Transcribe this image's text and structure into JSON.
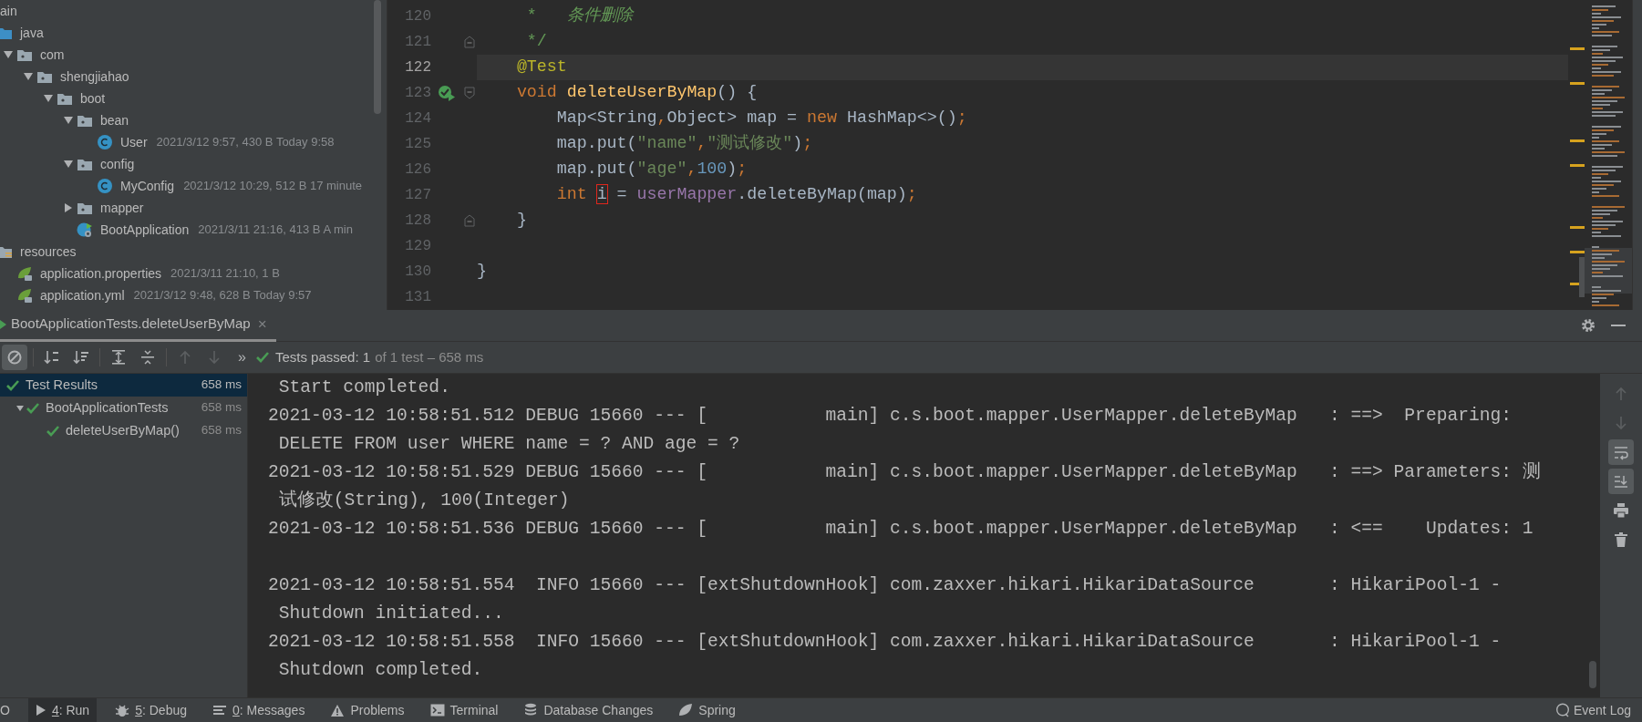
{
  "project_tree": {
    "items": [
      {
        "label": "ain",
        "children": [
          {
            "label": "java",
            "kind": "source-folder",
            "children": [
              {
                "label": "com",
                "kind": "package",
                "expanded": true,
                "children": [
                  {
                    "label": "shengjiahao",
                    "kind": "package",
                    "expanded": true,
                    "children": [
                      {
                        "label": "boot",
                        "kind": "package",
                        "expanded": true,
                        "children": [
                          {
                            "label": "bean",
                            "kind": "package",
                            "expanded": true,
                            "children": [
                              {
                                "label": "User",
                                "kind": "class",
                                "meta": "2021/3/12 9:57, 430 B Today 9:58"
                              }
                            ]
                          },
                          {
                            "label": "config",
                            "kind": "package",
                            "expanded": true,
                            "children": [
                              {
                                "label": "MyConfig",
                                "kind": "class",
                                "meta": "2021/3/12 10:29, 512 B 17 minute"
                              }
                            ]
                          },
                          {
                            "label": "mapper",
                            "kind": "package",
                            "expanded": false
                          },
                          {
                            "label": "BootApplication",
                            "kind": "spring-app",
                            "meta": "2021/3/11 21:16, 413 B A min"
                          }
                        ]
                      }
                    ]
                  }
                ]
              }
            ]
          },
          {
            "label": "resources",
            "kind": "resources-folder",
            "children": [
              {
                "label": "application.properties",
                "kind": "spring-config",
                "meta": "2021/3/11 21:10, 1 B"
              },
              {
                "label": "application.yml",
                "kind": "spring-config",
                "meta": "2021/3/12 9:48, 628 B Today 9:57"
              }
            ]
          }
        ]
      }
    ]
  },
  "editor": {
    "lines": [
      {
        "number": "120",
        "current": false,
        "run_marker": false,
        "fold_start": false,
        "fold_end": false,
        "tokens": [
          {
            "kind": "comment",
            "text": "     *   "
          },
          {
            "kind": "doc-text",
            "text": "条件删除"
          }
        ]
      },
      {
        "number": "121",
        "current": false,
        "run_marker": false,
        "fold_start": false,
        "fold_end": true,
        "tokens": [
          {
            "kind": "comment",
            "text": "     */"
          }
        ]
      },
      {
        "number": "122",
        "current": true,
        "run_marker": false,
        "fold_start": false,
        "fold_end": false,
        "tokens": [
          {
            "kind": "annotation",
            "text": "    @Test"
          }
        ]
      },
      {
        "number": "123",
        "current": false,
        "run_marker": true,
        "fold_start": true,
        "fold_end": false,
        "tokens": [
          {
            "kind": "keyword",
            "text": "    void "
          },
          {
            "kind": "method",
            "text": "deleteUserByMap"
          },
          {
            "kind": "plain",
            "text": "() {"
          }
        ]
      },
      {
        "number": "124",
        "current": false,
        "run_marker": false,
        "fold_start": false,
        "fold_end": false,
        "tokens": [
          {
            "kind": "plain",
            "text": "        Map<String"
          },
          {
            "kind": "keyword",
            "text": ","
          },
          {
            "kind": "plain",
            "text": "Object> map = "
          },
          {
            "kind": "keyword",
            "text": "new"
          },
          {
            "kind": "plain",
            "text": " HashMap<>()"
          },
          {
            "kind": "keyword",
            "text": ";"
          }
        ]
      },
      {
        "number": "125",
        "current": false,
        "run_marker": false,
        "fold_start": false,
        "fold_end": false,
        "tokens": [
          {
            "kind": "plain",
            "text": "        map.put("
          },
          {
            "kind": "string",
            "text": "\"name\""
          },
          {
            "kind": "keyword",
            "text": ","
          },
          {
            "kind": "string",
            "text": "\"测试修改\""
          },
          {
            "kind": "plain",
            "text": ")"
          },
          {
            "kind": "keyword",
            "text": ";"
          }
        ]
      },
      {
        "number": "126",
        "current": false,
        "run_marker": false,
        "fold_start": false,
        "fold_end": false,
        "tokens": [
          {
            "kind": "plain",
            "text": "        map.put("
          },
          {
            "kind": "string",
            "text": "\"age\""
          },
          {
            "kind": "keyword",
            "text": ","
          },
          {
            "kind": "number",
            "text": "100"
          },
          {
            "kind": "plain",
            "text": ")"
          },
          {
            "kind": "keyword",
            "text": ";"
          }
        ]
      },
      {
        "number": "127",
        "current": false,
        "run_marker": false,
        "fold_start": false,
        "fold_end": false,
        "tokens": [
          {
            "kind": "keyword",
            "text": "        int "
          },
          {
            "kind": "marked",
            "text": "i"
          },
          {
            "kind": "plain",
            "text": " = "
          },
          {
            "kind": "field",
            "text": "userMapper"
          },
          {
            "kind": "plain",
            "text": ".deleteByMap(map)"
          },
          {
            "kind": "keyword",
            "text": ";"
          }
        ]
      },
      {
        "number": "128",
        "current": false,
        "run_marker": false,
        "fold_start": false,
        "fold_end": true,
        "tokens": [
          {
            "kind": "plain",
            "text": "    }"
          }
        ]
      },
      {
        "number": "129",
        "current": false,
        "run_marker": false,
        "fold_start": false,
        "fold_end": false
      },
      {
        "number": "130",
        "current": false,
        "run_marker": false,
        "fold_start": false,
        "fold_end": false,
        "tokens": [
          {
            "kind": "plain",
            "text": "}"
          }
        ]
      },
      {
        "number": "131",
        "current": false,
        "run_marker": false,
        "fold_start": false,
        "fold_end": false
      }
    ]
  },
  "run_panel": {
    "tab": {
      "label": "BootApplicationTests.deleteUserByMap",
      "close": "×"
    },
    "tools": [
      {
        "kind": "show-passed",
        "on": true,
        "disabled": false
      },
      {
        "kind": "sort-alpha",
        "on": false,
        "disabled": false
      },
      {
        "kind": "sort-duration",
        "on": false,
        "disabled": false
      },
      {
        "kind": "expand-all",
        "on": false,
        "disabled": false
      },
      {
        "kind": "collapse-all",
        "on": false,
        "disabled": false
      },
      {
        "kind": "previous",
        "on": false,
        "disabled": true
      },
      {
        "kind": "next",
        "on": false,
        "disabled": true
      }
    ],
    "overflow": "»",
    "status": {
      "passed": true,
      "summary": "Tests passed: 1",
      "detail": "of 1 test – 658 ms"
    },
    "test_tree": [
      {
        "label": "Test Results",
        "duration": "658 ms",
        "passed": true,
        "selected": true,
        "children": [
          {
            "label": "BootApplicationTests",
            "duration": "658 ms",
            "passed": true,
            "selected": false,
            "expanded": true,
            "children": [
              {
                "label": "deleteUserByMap()",
                "duration": "658 ms",
                "passed": true,
                "selected": false
              }
            ]
          }
        ]
      }
    ],
    "console": {
      "lines": [
        {
          "text": " Start completed.",
          "gap_before": false
        },
        {
          "text": "2021-03-12 10:58:51.512 DEBUG 15660 --- [           main] c.s.boot.mapper.UserMapper.deleteByMap   : ==>  Preparing:",
          "gap_before": false
        },
        {
          "text": " DELETE FROM user WHERE name = ? AND age = ?",
          "gap_before": false
        },
        {
          "text": "2021-03-12 10:58:51.529 DEBUG 15660 --- [           main] c.s.boot.mapper.UserMapper.deleteByMap   : ==> Parameters: 测",
          "gap_before": false
        },
        {
          "text": " 试修改(String), 100(Integer)",
          "gap_before": false
        },
        {
          "text": "2021-03-12 10:58:51.536 DEBUG 15660 --- [           main] c.s.boot.mapper.UserMapper.deleteByMap   : <==    Updates: 1",
          "gap_before": false
        },
        {
          "text": "2021-03-12 10:58:51.554  INFO 15660 --- [extShutdownHook] com.zaxxer.hikari.HikariDataSource       : HikariPool-1 -",
          "gap_before": true
        },
        {
          "text": " Shutdown initiated...",
          "gap_before": false
        },
        {
          "text": "2021-03-12 10:58:51.558  INFO 15660 --- [extShutdownHook] com.zaxxer.hikari.HikariDataSource       : HikariPool-1 -",
          "gap_before": false
        },
        {
          "text": " Shutdown completed.",
          "gap_before": false
        }
      ]
    },
    "console_tools": [
      {
        "kind": "up",
        "on": false,
        "disabled": true
      },
      {
        "kind": "down",
        "on": false,
        "disabled": true
      },
      {
        "kind": "soft-wrap",
        "on": true,
        "disabled": false
      },
      {
        "kind": "scroll-to-end",
        "on": true,
        "disabled": false
      },
      {
        "kind": "print",
        "on": false,
        "disabled": false
      },
      {
        "kind": "clear",
        "on": false,
        "disabled": false
      }
    ]
  },
  "bottom_bar": {
    "tools": [
      {
        "kind": "todo",
        "label": "O",
        "selected": false
      },
      {
        "kind": "run",
        "mnemonic": "4",
        "label": ": Run",
        "selected": true
      },
      {
        "kind": "debug",
        "mnemonic": "5",
        "label": ": Debug",
        "selected": false
      },
      {
        "kind": "messages",
        "mnemonic": "0",
        "label": ": Messages",
        "selected": false
      },
      {
        "kind": "problems",
        "label": "Problems",
        "selected": false
      },
      {
        "kind": "terminal",
        "label": "Terminal",
        "selected": false
      },
      {
        "kind": "database",
        "label": "Database Changes",
        "selected": false
      },
      {
        "kind": "spring",
        "label": "Spring",
        "selected": false
      }
    ],
    "event_log": {
      "label": "Event Log"
    }
  }
}
